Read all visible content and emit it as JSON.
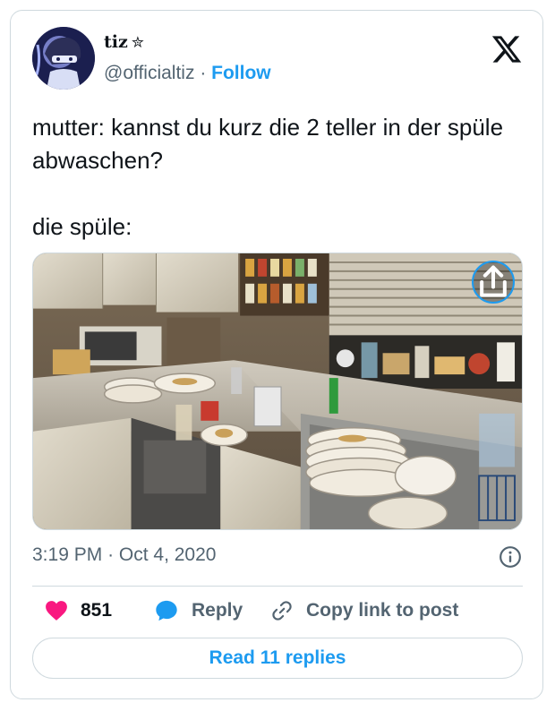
{
  "author": {
    "name": "tiz",
    "name_badge": "✮",
    "handle": "@officialtiz",
    "separator": "·",
    "follow_label": "Follow"
  },
  "tweet": {
    "lines": [
      "mutter: kannst du kurz die 2 teller in der spüle abwaschen?",
      "die spüle:"
    ]
  },
  "media": {
    "icon": "share-icon"
  },
  "meta": {
    "time": "3:19 PM",
    "separator": "·",
    "date": "Oct 4, 2020"
  },
  "actions": {
    "like_count": "851",
    "reply_label": "Reply",
    "copy_label": "Copy link to post"
  },
  "read_replies_label": "Read 11 replies",
  "colors": {
    "accent": "#1d9bf0",
    "like": "#f91880",
    "secondary_text": "#536471",
    "border": "#cfd9de"
  }
}
